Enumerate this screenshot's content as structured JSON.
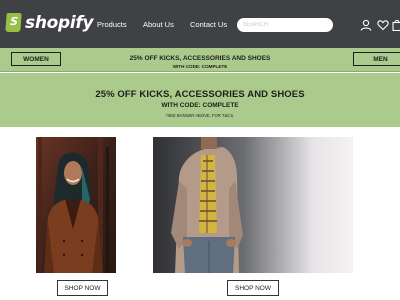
{
  "nav": {
    "logo_text": "shopify",
    "logo_glyph": "S",
    "links": [
      "Products",
      "About Us",
      "Contact Us"
    ],
    "search_placeholder": "SEARCH",
    "icons": [
      "user-icon",
      "heart-icon",
      "shopping-bag-icon"
    ]
  },
  "promo_strip": {
    "left_button": "WOMEN",
    "right_button": "MEN",
    "title": "25% OFF KICKS, ACCESSORIES AND SHOES",
    "code": "WITH CODE: COMPLETE"
  },
  "banner": {
    "title": "25% OFF KICKS, ACCESSORIES AND SHOES",
    "code": "WITH CODE: COMPLETE",
    "note": "*SEE BANNER ABOVE, FOR T&CS."
  },
  "products": [
    {
      "image": "woman-in-brown-coat-photo",
      "button": "SHOP NOW"
    },
    {
      "image": "man-in-beige-jacket-photo",
      "button": "SHOP NOW"
    }
  ],
  "colors": {
    "nav_bg": "#3f4145",
    "promo_green": "#aacb8c",
    "brand_green": "#95bf47"
  }
}
